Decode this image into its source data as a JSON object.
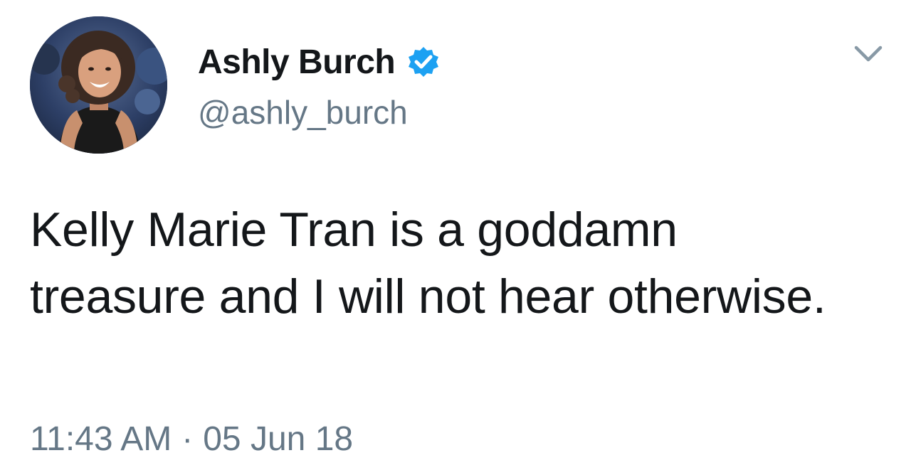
{
  "tweet": {
    "author": {
      "display_name": "Ashly Burch",
      "handle": "@ashly_burch",
      "verified": true,
      "avatar_icon": "profile-photo"
    },
    "text": "Kelly Marie Tran is a goddamn treasure and I will not hear otherwise.",
    "time": "11:43 AM",
    "separator": "·",
    "date": "05 Jun 18",
    "menu_icon": "chevron-down-icon"
  },
  "colors": {
    "text_primary": "#14171a",
    "text_secondary": "#657786",
    "verified_blue": "#1da1f2",
    "background": "#ffffff"
  }
}
